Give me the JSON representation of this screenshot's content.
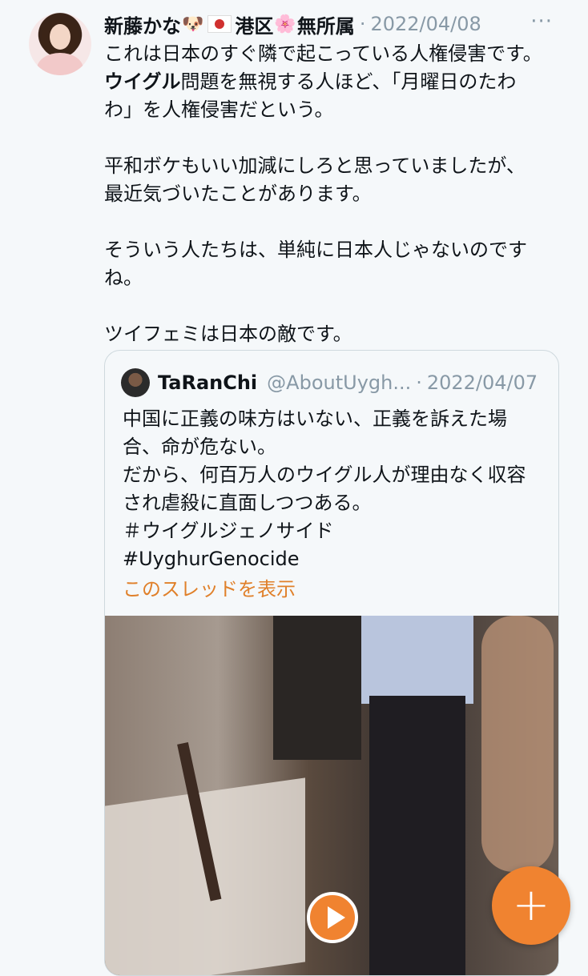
{
  "tweet": {
    "author_name": "新藤かな",
    "emoji_1": "🐶",
    "emoji_2": "港区",
    "emoji_3": "🌸",
    "affiliation": "無所属",
    "separator": "·",
    "date": "2022/04/08",
    "more_label": "···",
    "lines": [
      "これは日本のすぐ隣で起こっている人権侵害です。",
      "問題を無視する人ほど、「月曜日のたわ",
      "わ」を人権侵害だという。",
      "平和ボケもいい加減にしろと思っていましたが、",
      "最近気づいたことがあります。",
      "そういう人たちは、単純に日本人じゃないのです",
      "ね。",
      "ツイフェミは日本の敵です。"
    ],
    "bold_word": "ウイグル"
  },
  "quote": {
    "author_name": "TaRanChi",
    "handle": "@AboutUygh...",
    "separator": "·",
    "date": "2022/04/07",
    "lines": [
      "中国に正義の味方はいない、正義を訴えた場",
      "合、命が危ない。",
      "だから、何百万人のウイグル人が理由なく収容",
      "され虐殺に直面しつつある。",
      "＃ウイグルジェノサイド",
      "#UyghurGenocide"
    ],
    "thread_link": "このスレッドを表示"
  },
  "fab": {
    "icon": "plus-icon",
    "label": "+"
  },
  "colors": {
    "accent": "#f08330",
    "muted": "#8899a6",
    "background": "#f5f8fa"
  }
}
